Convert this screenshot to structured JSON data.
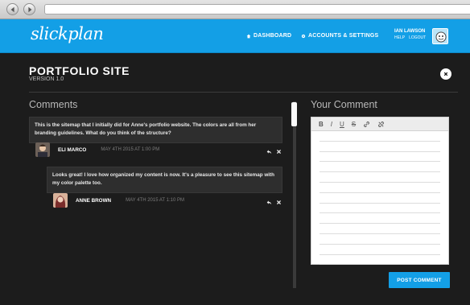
{
  "browser": {},
  "header": {
    "logo": "slickplan",
    "nav": [
      {
        "label": "DASHBOARD",
        "icon": "home-icon"
      },
      {
        "label": "ACCOUNTS & SETTINGS",
        "icon": "gear-icon"
      }
    ],
    "user": {
      "name": "IAN LAWSON",
      "help": "HELP",
      "logout": "LOGOUT"
    }
  },
  "modal": {
    "title": "PORTFOLIO SITE",
    "version": "VERSION 1.0"
  },
  "comments": {
    "title": "Comments",
    "items": [
      {
        "text": "This is the sitemap that I initially did for Anne's portfolio website. The colors are all from her branding guidelines. What do you think of the structure?",
        "author": "ELI MARCO",
        "date": "MAY 4TH 2015 AT 1:00 PM"
      },
      {
        "text": "Looks great! I love how organized my content is now. It's a pleasure to see this sitemap with my color palette too.",
        "author": "ANNE BROWN",
        "date": "MAY 4TH 2015 AT 1:10 PM"
      }
    ]
  },
  "your_comment": {
    "title": "Your Comment",
    "toolbar": [
      "B",
      "I",
      "U",
      "S"
    ],
    "post_label": "POST COMMENT"
  },
  "colors": {
    "accent": "#139fe6",
    "background": "#1c1c1c"
  }
}
